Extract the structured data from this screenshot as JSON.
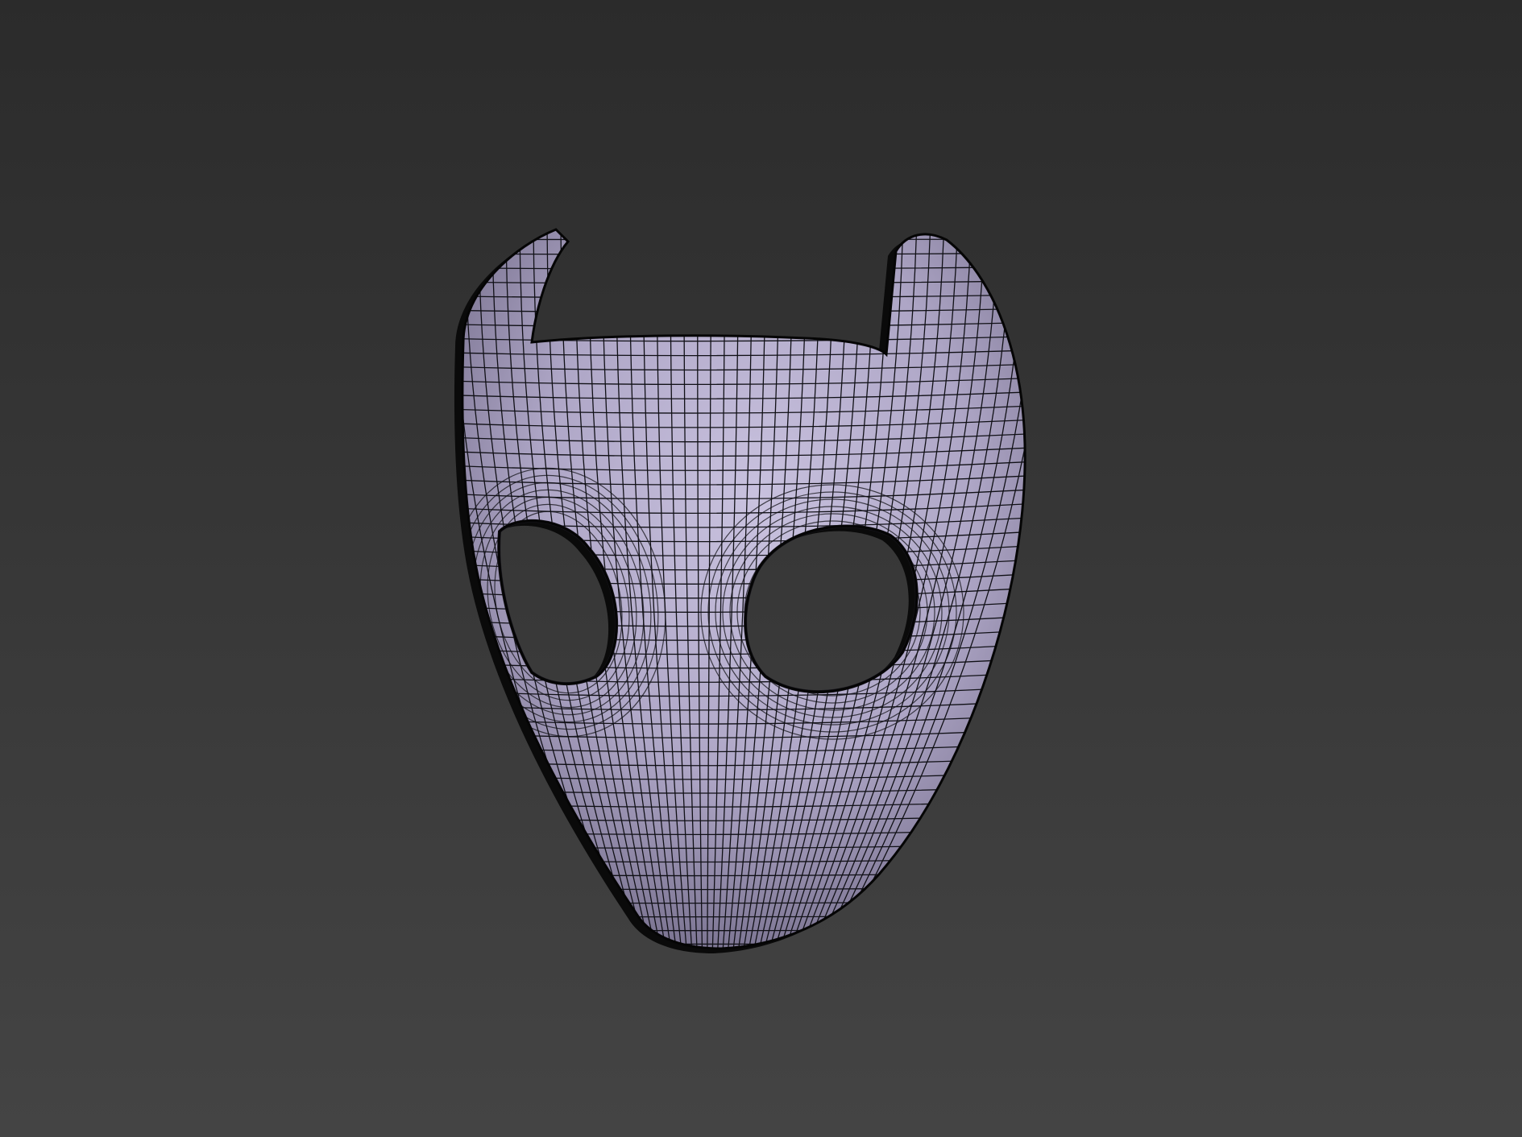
{
  "viewport": {
    "background_top": "#2b2b2b",
    "background_bottom": "#444444"
  },
  "model": {
    "object": "mask",
    "material_color": "#aea6c6",
    "material_highlight": "#c9c2df",
    "material_shadow": "#5f5a73",
    "wireframe_color": "#101016",
    "outline_color": "#050505",
    "shading": "smooth-shaded-with-wireframe"
  }
}
